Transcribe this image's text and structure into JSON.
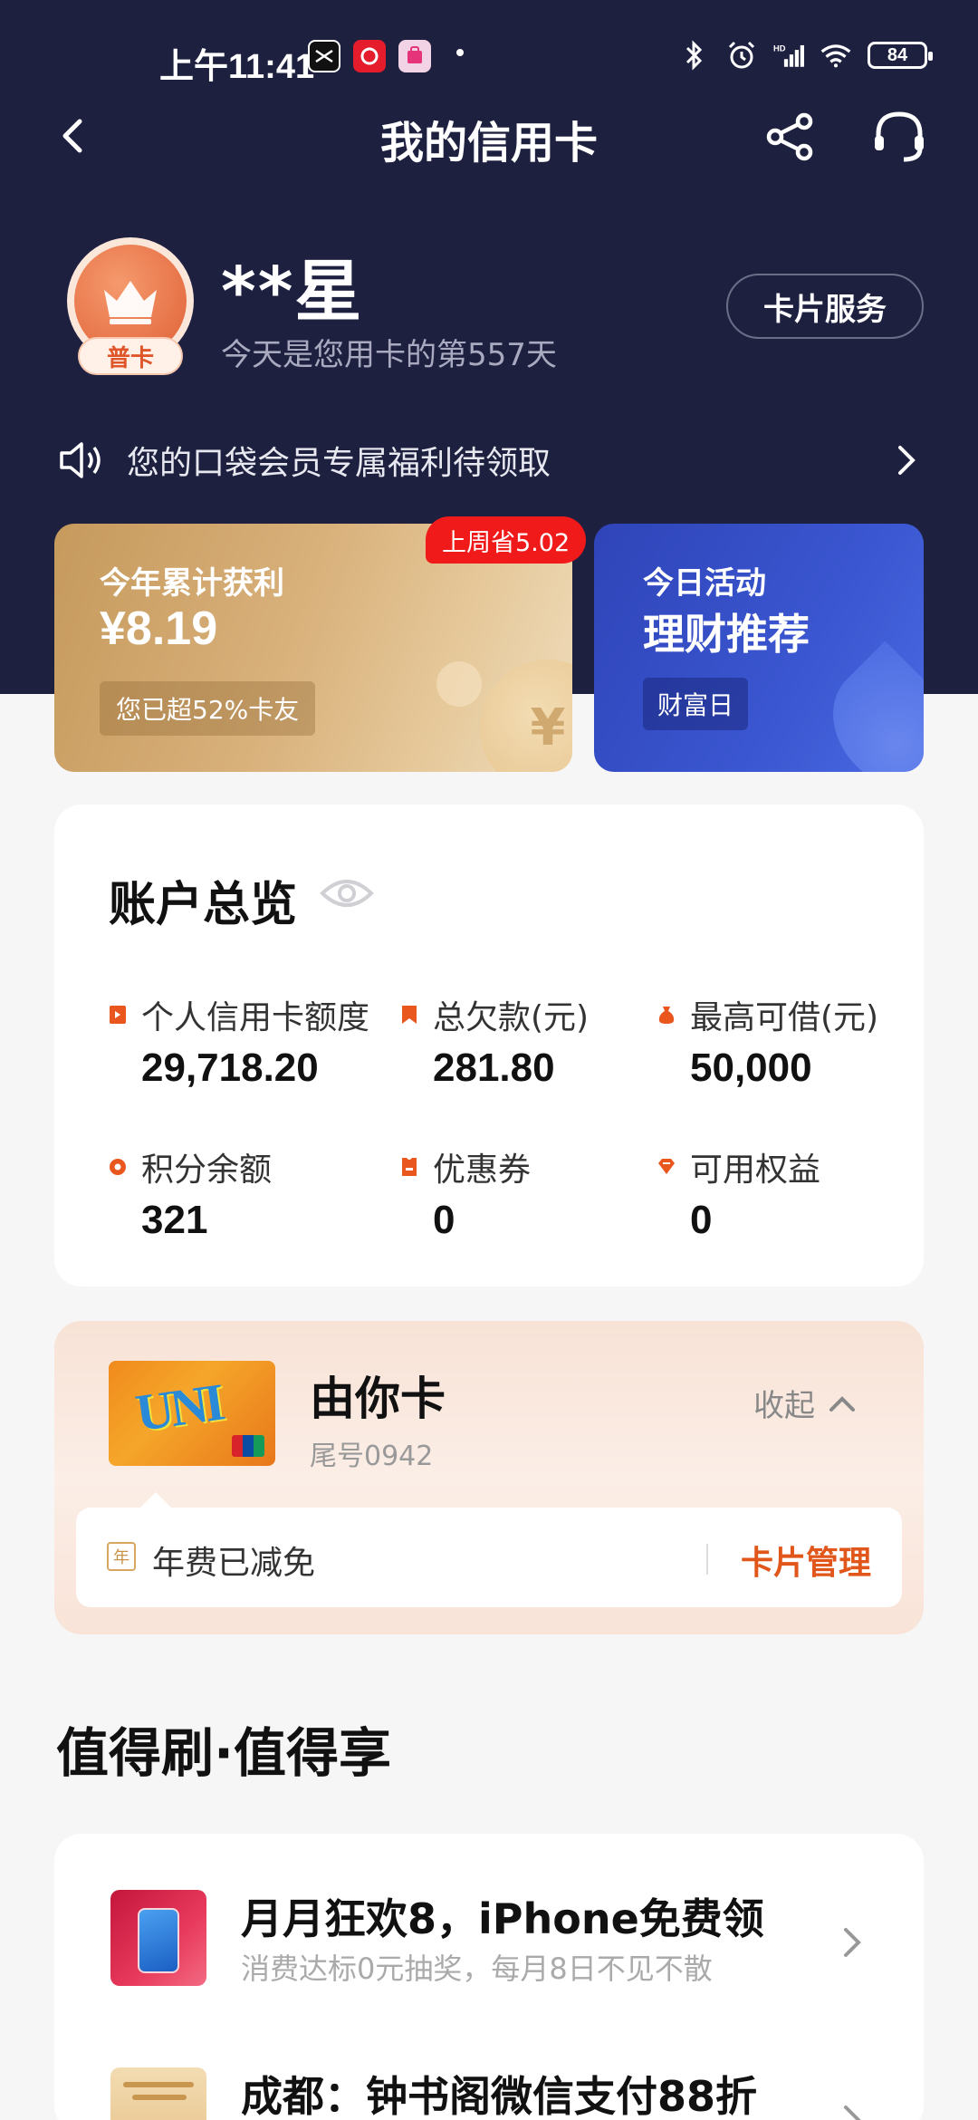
{
  "status_bar": {
    "time": "上午11:41",
    "battery": "84"
  },
  "nav": {
    "title": "我的信用卡"
  },
  "profile": {
    "name": "**星",
    "level_badge": "普卡",
    "days_text": "今天是您用卡的第557天",
    "card_service_label": "卡片服务"
  },
  "notice": {
    "text": "您的口袋会员专属福利待领取"
  },
  "promo_left": {
    "label": "今年累计获利",
    "value": "¥8.19",
    "chip": "您已超52%卡友",
    "badge": "上周省5.02",
    "coin_glyph": "¥"
  },
  "promo_right": {
    "label": "今日活动",
    "value": "理财推荐",
    "chip": "财富日"
  },
  "overview": {
    "title": "账户总览",
    "metrics": [
      {
        "label": "个人信用卡额度",
        "value": "29,718.20"
      },
      {
        "label": "总欠款(元)",
        "value": "281.80"
      },
      {
        "label": "最高可借(元)",
        "value": "50,000"
      },
      {
        "label": "积分余额",
        "value": "321"
      },
      {
        "label": "优惠券",
        "value": "0"
      },
      {
        "label": "可用权益",
        "value": "0"
      }
    ],
    "accent_color": "#e9561e"
  },
  "card": {
    "name": "由你卡",
    "tail": "尾号0942",
    "collapse_label": "收起",
    "fee_icon_char": "年",
    "fee_text": "年费已减免",
    "manage_label": "卡片管理",
    "thumb_text": "UNI"
  },
  "recommend": {
    "section_title": "值得刷·值得享",
    "items": [
      {
        "title": "月月狂欢8，iPhone免费领",
        "subtitle": "消费达标0元抽奖，每月8日不见不散",
        "icon": "iphone-promo-thumb"
      },
      {
        "title": "成都：钟书阁微信支付88折",
        "subtitle": "",
        "icon": "bookstore-promo-thumb"
      }
    ]
  }
}
